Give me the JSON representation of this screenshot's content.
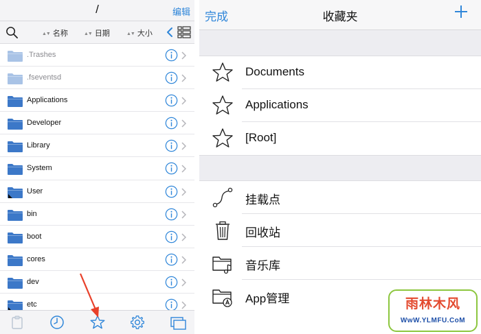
{
  "left": {
    "title": "/",
    "edit_label": "编辑",
    "sort": {
      "name": "名称",
      "date": "日期",
      "size": "大小"
    },
    "rows": [
      {
        "name": ".Trashes",
        "dim": true
      },
      {
        "name": ".fseventsd",
        "dim": true
      },
      {
        "name": "Applications",
        "dim": false
      },
      {
        "name": "Developer",
        "dim": false
      },
      {
        "name": "Library",
        "dim": false
      },
      {
        "name": "System",
        "dim": false
      },
      {
        "name": "User",
        "dim": false,
        "alias": true
      },
      {
        "name": "bin",
        "dim": false
      },
      {
        "name": "boot",
        "dim": false
      },
      {
        "name": "cores",
        "dim": false
      },
      {
        "name": "dev",
        "dim": false
      },
      {
        "name": "etc",
        "dim": false,
        "alias": true
      }
    ],
    "tabs": [
      "clipboard-icon",
      "clock-icon",
      "star-icon",
      "gear-icon",
      "windows-icon"
    ]
  },
  "right": {
    "done_label": "完成",
    "title": "收藏夹",
    "favorites": [
      "Documents",
      "Applications",
      "[Root]"
    ],
    "places": [
      {
        "label": "挂载点",
        "icon": "mount-point-icon"
      },
      {
        "label": "回收站",
        "icon": "trash-icon"
      },
      {
        "label": "音乐库",
        "icon": "music-folder-icon"
      },
      {
        "label": "App管理",
        "icon": "app-folder-icon"
      }
    ]
  },
  "watermark": {
    "top": "雨林木风",
    "bottom": "WwW.YLMFU.CoM"
  },
  "colors": {
    "accent": "#2f86d9",
    "folder": "#3c78c8",
    "folder_dim": "#a9c3e6",
    "arrow": "#e8402a"
  }
}
